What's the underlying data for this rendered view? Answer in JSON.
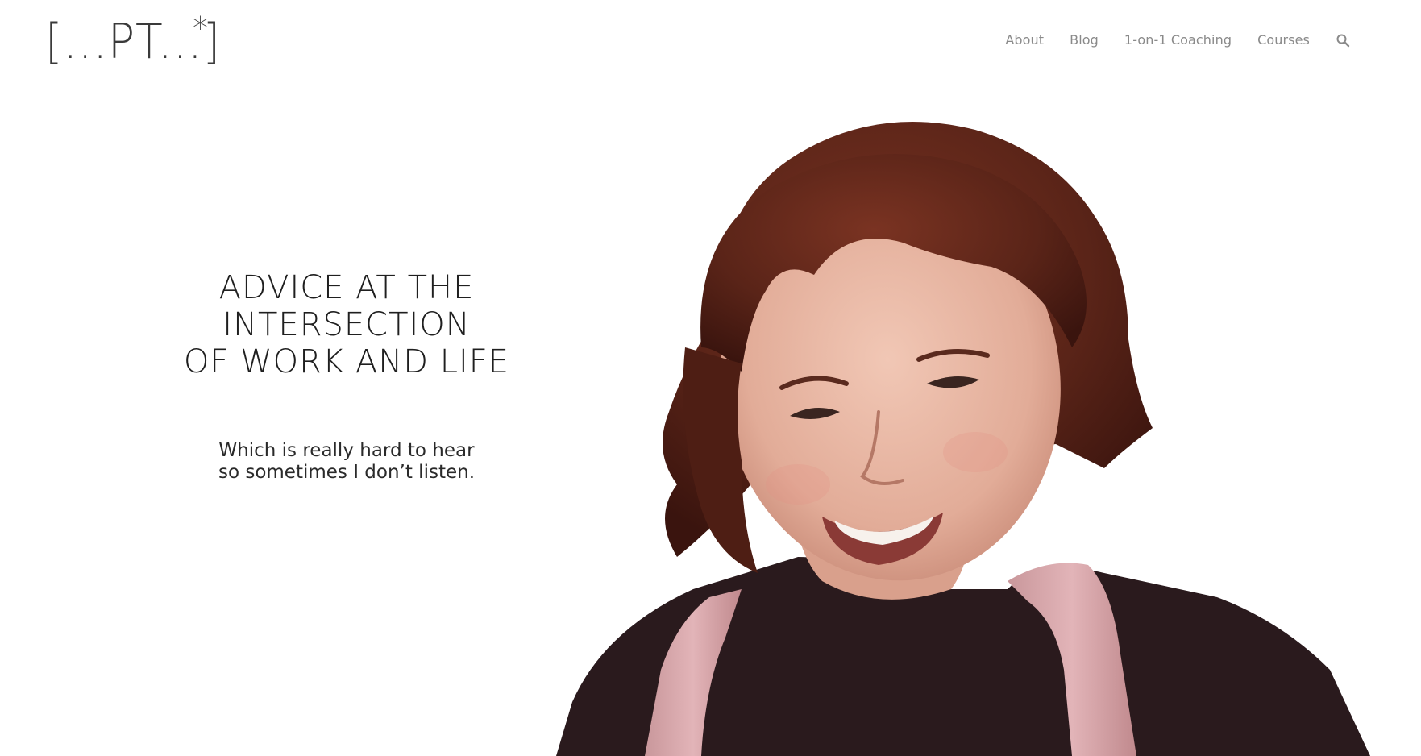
{
  "header": {
    "logo_text": "[...PT...]",
    "logo_mark": "*",
    "nav": [
      {
        "label": "About"
      },
      {
        "label": "Blog"
      },
      {
        "label": "1-on-1 Coaching"
      },
      {
        "label": "Courses"
      }
    ],
    "search_icon": "search-icon"
  },
  "hero": {
    "headline_lines": [
      "ADVICE AT THE",
      "INTERSECTION",
      "OF WORK AND LIFE"
    ],
    "sub_lines": [
      "Which is really hard to hear",
      "so sometimes I don’t listen."
    ],
    "portrait_icon": "smiling-woman-portrait"
  },
  "colors": {
    "nav_text": "#8a8a8a",
    "headline_text": "#1f1f1f",
    "hair": "#5a2418",
    "skin": "#e9b9a7",
    "shirt": "#2a1a1d",
    "straps": "#d9a9ad"
  }
}
